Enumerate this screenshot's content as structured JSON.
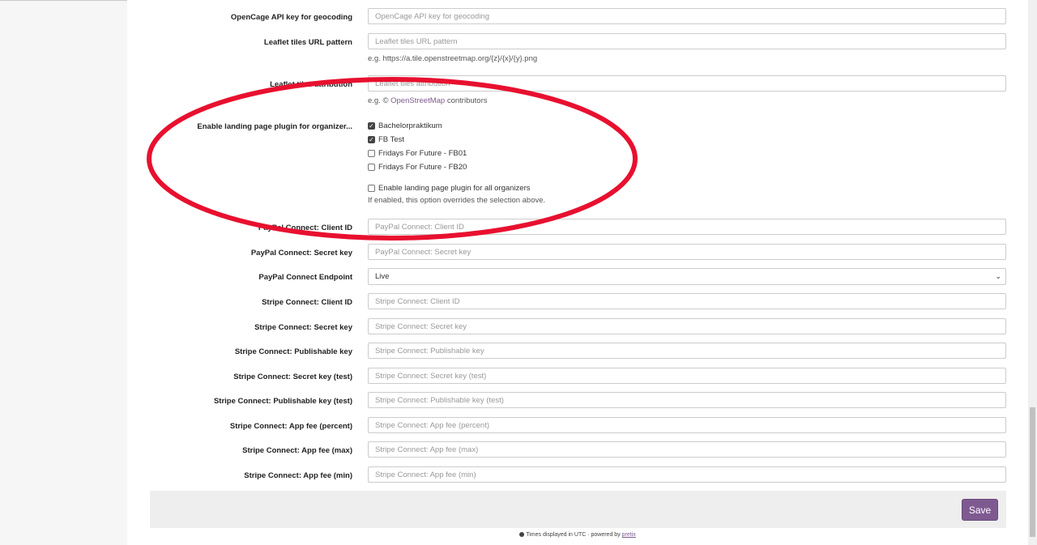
{
  "form": {
    "fields_top": [
      {
        "label": "OpenCage API key for geocoding",
        "placeholder": "OpenCage API key for geocoding"
      },
      {
        "label": "Leaflet tiles URL pattern",
        "placeholder": "Leaflet tiles URL pattern",
        "help": "e.g. https://a.tile.openstreetmap.org/{z}/{x}/{y}.png"
      },
      {
        "label": "Leaflet tiles attribution",
        "placeholder": "Leaflet tiles attribution",
        "help_prefix": "e.g. © ",
        "help_link": "OpenStreetMap",
        "help_suffix": " contributors"
      }
    ],
    "landing": {
      "label": "Enable landing page plugin for organizer...",
      "organizers": [
        {
          "name": "Bachelorpraktikum",
          "checked": true
        },
        {
          "name": "FB Test",
          "checked": true
        },
        {
          "name": "Fridays For Future - FB01",
          "checked": false
        },
        {
          "name": "Fridays For Future - FB20",
          "checked": false
        }
      ],
      "all_label": "Enable landing page plugin for all organizers",
      "all_checked": false,
      "help": "If enabled, this option overrides the selection above."
    },
    "paypal_client": {
      "label": "PayPal Connect: Client ID",
      "placeholder": "PayPal Connect: Client ID"
    },
    "paypal_secret": {
      "label": "PayPal Connect: Secret key",
      "placeholder": "PayPal Connect: Secret key"
    },
    "paypal_endpoint": {
      "label": "PayPal Connect Endpoint",
      "value": "Live"
    },
    "stripe_fields": [
      {
        "label": "Stripe Connect: Client ID",
        "placeholder": "Stripe Connect: Client ID"
      },
      {
        "label": "Stripe Connect: Secret key",
        "placeholder": "Stripe Connect: Secret key"
      },
      {
        "label": "Stripe Connect: Publishable key",
        "placeholder": "Stripe Connect: Publishable key"
      },
      {
        "label": "Stripe Connect: Secret key (test)",
        "placeholder": "Stripe Connect: Secret key (test)"
      },
      {
        "label": "Stripe Connect: Publishable key (test)",
        "placeholder": "Stripe Connect: Publishable key (test)"
      },
      {
        "label": "Stripe Connect: App fee (percent)",
        "placeholder": "Stripe Connect: App fee (percent)"
      },
      {
        "label": "Stripe Connect: App fee (max)",
        "placeholder": "Stripe Connect: App fee (max)"
      },
      {
        "label": "Stripe Connect: App fee (min)",
        "placeholder": "Stripe Connect: App fee (min)"
      }
    ],
    "save_label": "Save"
  },
  "footer": {
    "text": "Times displayed in UTC · powered by ",
    "link": "pretix"
  },
  "colors": {
    "accent": "#7f5a91",
    "annotation": "#e8102f"
  }
}
